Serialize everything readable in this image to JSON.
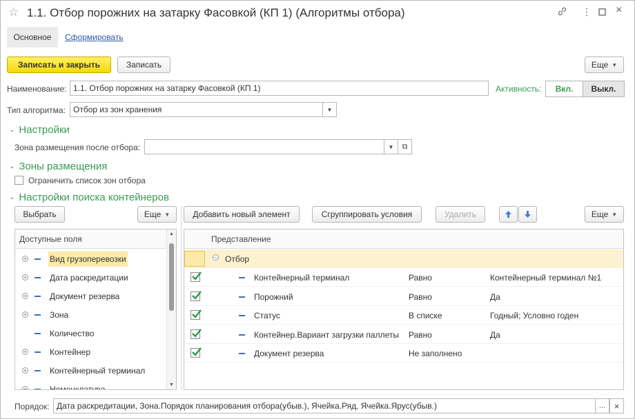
{
  "window": {
    "title": "1.1. Отбор порожних на затарку Фасовкой (КП 1) (Алгоритмы отбора)",
    "icons": [
      "star-icon",
      "link-icon",
      "more-icon",
      "maximize-icon",
      "close-icon"
    ]
  },
  "tabs": {
    "main": "Основное",
    "generate": "Сформировать"
  },
  "toolbar": {
    "save_close": "Записать и закрыть",
    "save": "Записать",
    "more": "Еще"
  },
  "fields": {
    "name_label": "Наименование:",
    "name_value": "1.1. Отбор порожних на затарку Фасовкой (КП 1)",
    "activity_label": "Активность:",
    "on_label": "Вкл.",
    "off_label": "Выкл.",
    "algo_label": "Тип алгоритма:",
    "algo_value": "Отбор из зон хранения"
  },
  "sections": {
    "settings": "Настройки",
    "zone_after_label": "Зона размещения после отбора:",
    "zone_after_value": "",
    "zones": "Зоны размещения",
    "limit_zones_label": "Ограничить список зон отбора",
    "container_search": "Настройки поиска контейнеров"
  },
  "left_panel": {
    "select_button": "Выбрать",
    "more_button": "Еще",
    "header": "Доступные поля",
    "fields": [
      {
        "label": "Вид грузоперевозки",
        "expandable": true,
        "selected": true
      },
      {
        "label": "Дата раскредитации",
        "expandable": true,
        "selected": false
      },
      {
        "label": "Документ резерва",
        "expandable": true,
        "selected": false
      },
      {
        "label": "Зона",
        "expandable": true,
        "selected": false
      },
      {
        "label": "Количество",
        "expandable": false,
        "selected": false
      },
      {
        "label": "Контейнер",
        "expandable": true,
        "selected": false
      },
      {
        "label": "Контейнерный терминал",
        "expandable": true,
        "selected": false
      },
      {
        "label": "Номенклатура",
        "expandable": true,
        "selected": false
      }
    ]
  },
  "right_panel": {
    "add_button": "Добавить новый элемент",
    "group_button": "Сгруппировать условия",
    "delete_button": "Удалить",
    "more_button": "Еще",
    "header": "Представление",
    "group_label": "Отбор",
    "rows": [
      {
        "field": "Контейнерный терминал",
        "condition": "Равно",
        "value": "Контейнерный терминал №1",
        "checked": true
      },
      {
        "field": "Порожний",
        "condition": "Равно",
        "value": "Да",
        "checked": true
      },
      {
        "field": "Статус",
        "condition": "В списке",
        "value": "Годный; Условно годен",
        "checked": true
      },
      {
        "field": "Контейнер.Вариант загрузки паллеты",
        "condition": "Равно",
        "value": "Да",
        "checked": true
      },
      {
        "field": "Документ резерва",
        "condition": "Не заполнено",
        "value": "",
        "checked": true
      }
    ]
  },
  "order": {
    "label": "Порядок:",
    "value": "Дата раскредитации, Зона.Порядок планирования отбора(убыв.), Ячейка.Ряд, Ячейка.Ярус(убыв.)",
    "select_icon": "...",
    "clear_icon": "×"
  },
  "colors": {
    "accent_green": "#3a9a55",
    "yellow_button": "#f5d80a",
    "link_blue": "#2d5aa8",
    "group_row": "#fdf2cf"
  }
}
